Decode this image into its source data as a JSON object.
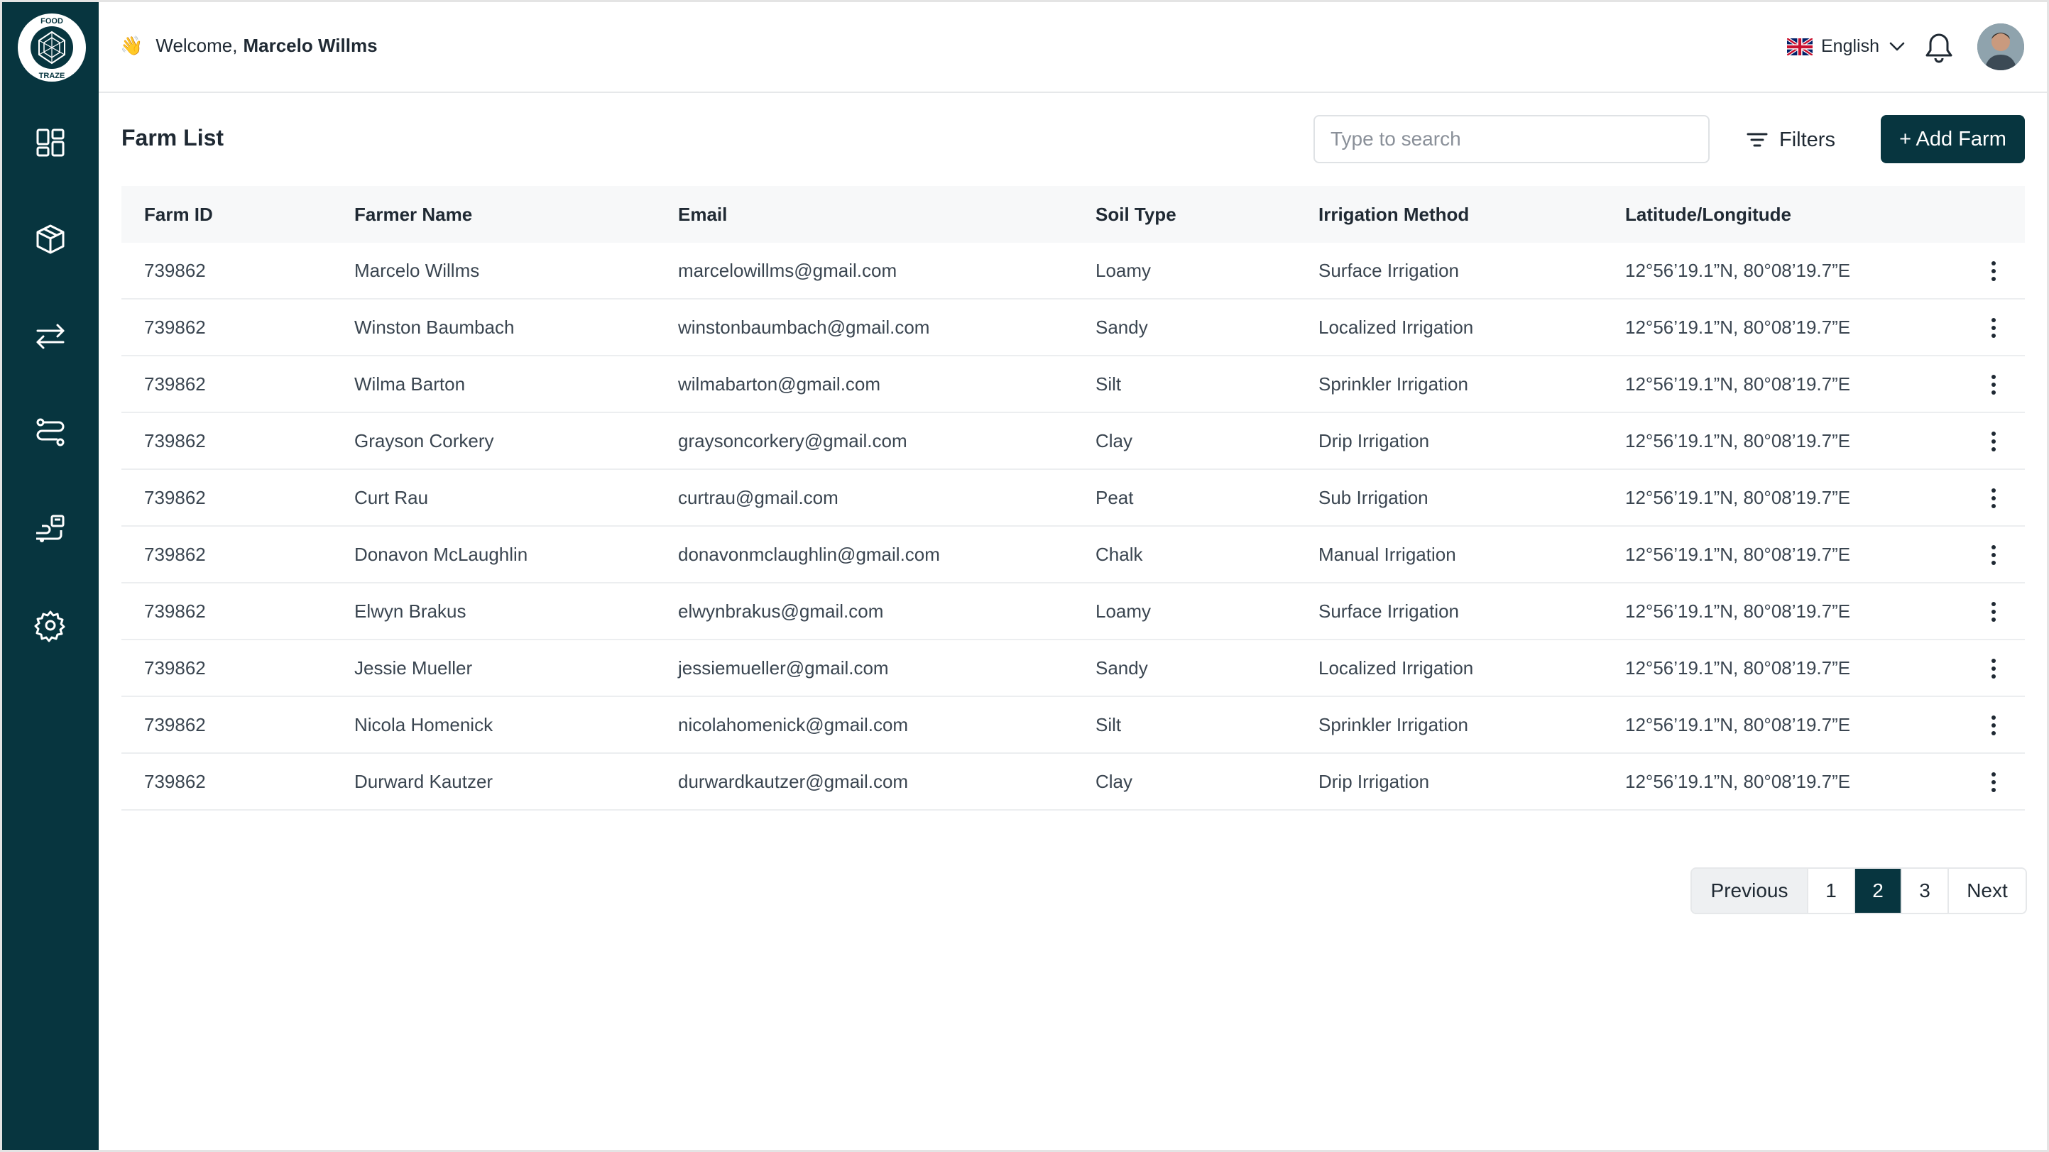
{
  "app": {
    "logo_text_top": "FOOD",
    "logo_text_bottom": "TRAZE"
  },
  "sidebar": {
    "items": [
      {
        "name": "dashboard",
        "icon": "dashboard-grid-icon"
      },
      {
        "name": "products",
        "icon": "package-box-icon"
      },
      {
        "name": "transactions",
        "icon": "transfer-arrows-icon"
      },
      {
        "name": "routes",
        "icon": "route-icon"
      },
      {
        "name": "traceability",
        "icon": "delivery-icon"
      },
      {
        "name": "settings",
        "icon": "gear-icon"
      }
    ]
  },
  "header": {
    "welcome_prefix": "Welcome,",
    "user_name": "Marcelo Willms",
    "language": "English",
    "wave_emoji": "👋"
  },
  "toolbar": {
    "title": "Farm List",
    "search_placeholder": "Type to search",
    "filters_label": "Filters",
    "add_label": "+ Add Farm"
  },
  "table": {
    "columns": [
      "Farm ID",
      "Farmer Name",
      "Email",
      "Soil Type",
      "Irrigation Method",
      "Latitude/Longitude"
    ],
    "rows": [
      {
        "id": "739862",
        "name": "Marcelo Willms",
        "email": "marcelowillms@gmail.com",
        "soil": "Loamy",
        "irrigation": "Surface Irrigation",
        "coords": "12°56’19.1”N, 80°08’19.7”E"
      },
      {
        "id": "739862",
        "name": "Winston Baumbach",
        "email": "winstonbaumbach@gmail.com",
        "soil": "Sandy",
        "irrigation": "Localized Irrigation",
        "coords": "12°56’19.1”N, 80°08’19.7”E"
      },
      {
        "id": "739862",
        "name": "Wilma Barton",
        "email": "wilmabarton@gmail.com",
        "soil": "Silt",
        "irrigation": "Sprinkler Irrigation",
        "coords": "12°56’19.1”N, 80°08’19.7”E"
      },
      {
        "id": "739862",
        "name": "Grayson Corkery",
        "email": "graysoncorkery@gmail.com",
        "soil": "Clay",
        "irrigation": "Drip Irrigation",
        "coords": "12°56’19.1”N, 80°08’19.7”E"
      },
      {
        "id": "739862",
        "name": "Curt Rau",
        "email": "curtrau@gmail.com",
        "soil": "Peat",
        "irrigation": "Sub Irrigation",
        "coords": "12°56’19.1”N, 80°08’19.7”E"
      },
      {
        "id": "739862",
        "name": "Donavon McLaughlin",
        "email": "donavonmclaughlin@gmail.com",
        "soil": "Chalk",
        "irrigation": "Manual Irrigation",
        "coords": "12°56’19.1”N, 80°08’19.7”E"
      },
      {
        "id": "739862",
        "name": "Elwyn Brakus",
        "email": "elwynbrakus@gmail.com",
        "soil": "Loamy",
        "irrigation": "Surface Irrigation",
        "coords": "12°56’19.1”N, 80°08’19.7”E"
      },
      {
        "id": "739862",
        "name": "Jessie Mueller",
        "email": "jessiemueller@gmail.com",
        "soil": "Sandy",
        "irrigation": "Localized Irrigation",
        "coords": "12°56’19.1”N, 80°08’19.7”E"
      },
      {
        "id": "739862",
        "name": "Nicola Homenick",
        "email": "nicolahomenick@gmail.com",
        "soil": "Silt",
        "irrigation": "Sprinkler Irrigation",
        "coords": "12°56’19.1”N, 80°08’19.7”E"
      },
      {
        "id": "739862",
        "name": "Durward Kautzer",
        "email": "durwardkautzer@gmail.com",
        "soil": "Clay",
        "irrigation": "Drip Irrigation",
        "coords": "12°56’19.1”N, 80°08’19.7”E"
      }
    ]
  },
  "pagination": {
    "previous": "Previous",
    "pages": [
      "1",
      "2",
      "3"
    ],
    "current": "2",
    "next": "Next"
  },
  "colors": {
    "brand": "#07353f",
    "header_bg": "#f7f8f9",
    "border": "#e6e8ea"
  }
}
